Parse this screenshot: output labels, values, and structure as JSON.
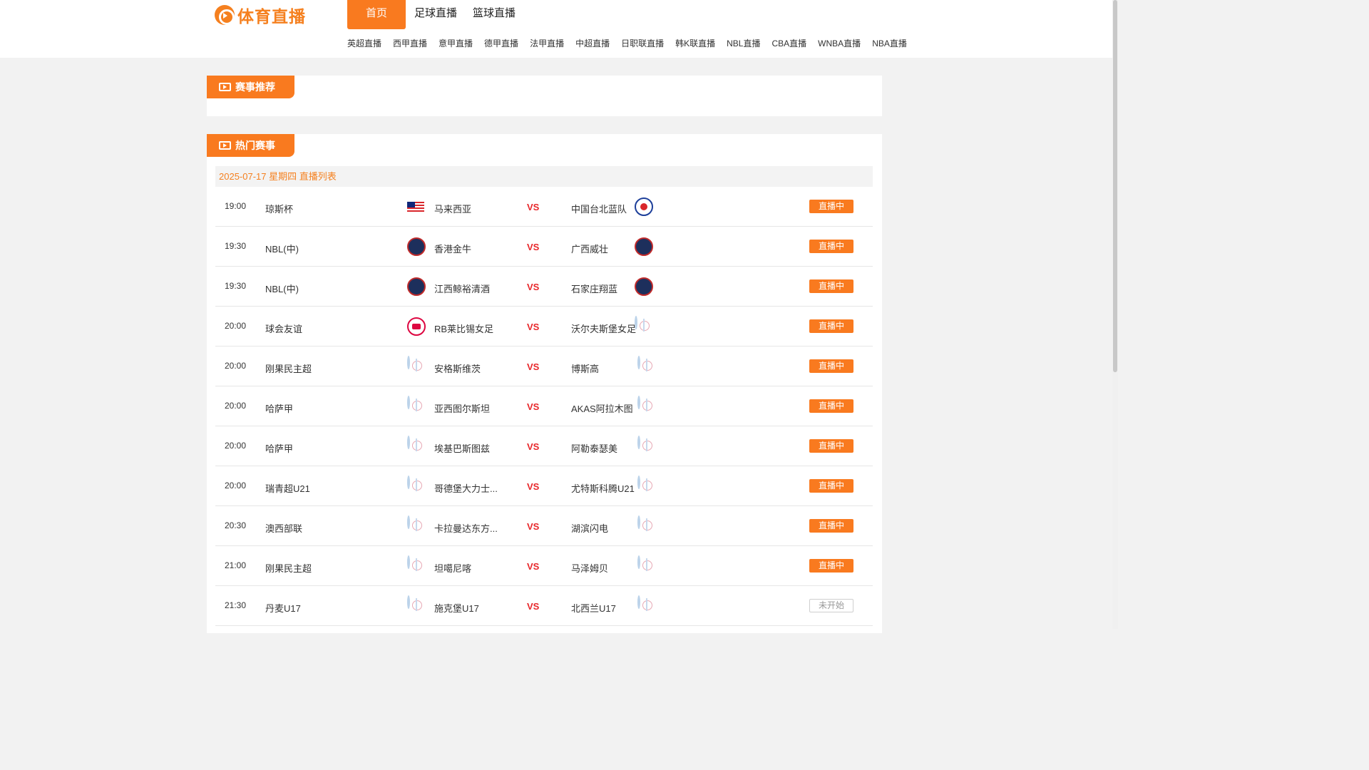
{
  "site": {
    "logo_text": "体育直播"
  },
  "nav_main": [
    "首页",
    "足球直播",
    "篮球直播"
  ],
  "nav_sub": [
    "英超直播",
    "西甲直播",
    "意甲直播",
    "德甲直播",
    "法甲直播",
    "中超直播",
    "日职联直播",
    "韩K联直播",
    "NBL直播",
    "CBA直播",
    "WNBA直播",
    "NBA直播"
  ],
  "section_recommend": "赛事推荐",
  "section_hot": "热门赛事",
  "date_header": "2025-07-17 星期四 直播列表",
  "vs_label": "VS",
  "status_live": "直播中",
  "status_pending": "未开始",
  "matches": [
    {
      "time": "19:00",
      "league": "琼斯杯",
      "home": "马来西亚",
      "away": "中国台北蓝队",
      "status": "直播中",
      "home_logo": "malaysia-flag-icon",
      "away_logo": "chinese-taipei-logo-icon"
    },
    {
      "time": "19:30",
      "league": "NBL(中)",
      "home": "香港金牛",
      "away": "广西威壮",
      "status": "直播中",
      "home_logo": "team-logo-icon",
      "away_logo": "team-logo-icon"
    },
    {
      "time": "19:30",
      "league": "NBL(中)",
      "home": "江西鲸裕清酒",
      "away": "石家庄翔蓝",
      "status": "直播中",
      "home_logo": "team-logo-icon",
      "away_logo": "team-logo-icon"
    },
    {
      "time": "20:00",
      "league": "球会友谊",
      "home": "RB莱比锡女足",
      "away": "沃尔夫斯堡女足",
      "status": "直播中",
      "home_logo": "rb-leipzig-logo-icon",
      "away_logo": "placeholder-logo-icon"
    },
    {
      "time": "20:00",
      "league": "刚果民主超",
      "home": "安格斯维茨",
      "away": "博斯高",
      "status": "直播中",
      "home_logo": "placeholder-logo-icon",
      "away_logo": "placeholder-logo-icon"
    },
    {
      "time": "20:00",
      "league": "哈萨甲",
      "home": "亚西图尔斯坦",
      "away": "AKAS阿拉木图",
      "status": "直播中",
      "home_logo": "placeholder-logo-icon",
      "away_logo": "placeholder-logo-icon"
    },
    {
      "time": "20:00",
      "league": "哈萨甲",
      "home": "埃基巴斯图兹",
      "away": "阿勒泰瑟美",
      "status": "直播中",
      "home_logo": "placeholder-logo-icon",
      "away_logo": "placeholder-logo-icon"
    },
    {
      "time": "20:00",
      "league": "瑞青超U21",
      "home": "哥德堡大力士...",
      "away": "尤特斯科腾U21",
      "status": "直播中",
      "home_logo": "placeholder-logo-icon",
      "away_logo": "placeholder-logo-icon"
    },
    {
      "time": "20:30",
      "league": "澳西部联",
      "home": "卡拉曼达东方...",
      "away": "湖滨闪电",
      "status": "直播中",
      "home_logo": "placeholder-logo-icon",
      "away_logo": "placeholder-logo-icon"
    },
    {
      "time": "21:00",
      "league": "刚果民主超",
      "home": "坦噶尼喀",
      "away": "马泽姆贝",
      "status": "直播中",
      "home_logo": "placeholder-logo-icon",
      "away_logo": "placeholder-logo-icon"
    },
    {
      "time": "21:30",
      "league": "丹麦U17",
      "home": "施克堡U17",
      "away": "北西兰U17",
      "status": "未开始",
      "home_logo": "placeholder-logo-icon",
      "away_logo": "placeholder-logo-icon"
    }
  ],
  "colors": {
    "accent": "#f97a1f",
    "vs": "#e8262a",
    "date": "#f5801f"
  }
}
